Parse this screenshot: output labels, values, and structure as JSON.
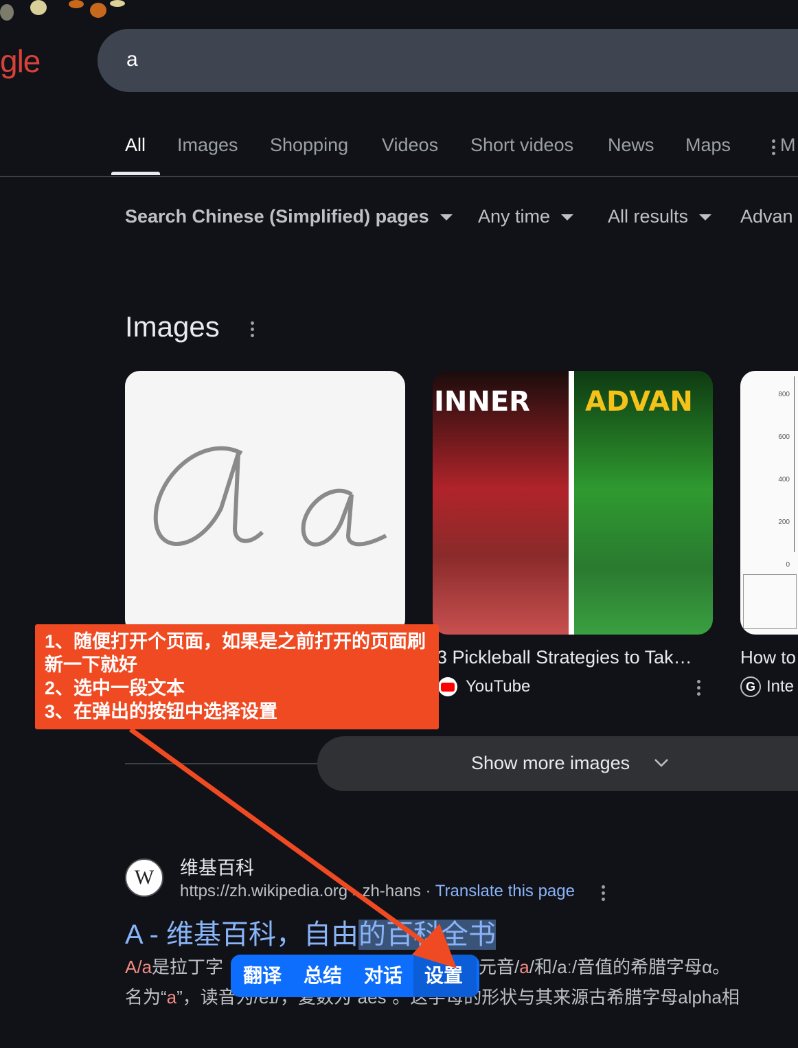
{
  "header": {
    "logo": "gle",
    "search_value": "a"
  },
  "tabs": [
    {
      "label": "All",
      "active": true
    },
    {
      "label": "Images"
    },
    {
      "label": "Shopping"
    },
    {
      "label": "Videos"
    },
    {
      "label": "Short videos"
    },
    {
      "label": "News"
    },
    {
      "label": "Maps"
    },
    {
      "label": "M"
    }
  ],
  "filters": [
    "Search Chinese (Simplified) pages",
    "Any time",
    "All results",
    "Advan"
  ],
  "images_section": {
    "heading": "Images",
    "cards": [
      {
        "caption": "",
        "source": ""
      },
      {
        "caption": "3 Pickleball Strategies to Tak…",
        "source": "YouTube",
        "overlay_text_left": "INNER",
        "overlay_text_right": "ADVAN"
      },
      {
        "caption": "How to",
        "source": "Inte",
        "chart_ticks": [
          "800",
          "600",
          "400",
          "200",
          "0"
        ]
      }
    ],
    "show_more": "Show more images"
  },
  "callout": {
    "lines": [
      "1、随便打开个页面，如果是之前打开的页面刷新一下就好",
      "2、选中一段文本",
      "3、在弹出的按钮中选择设置"
    ],
    "color": "#f04a23"
  },
  "result": {
    "site_name": "维基百科",
    "url": "https://zh.wikipedia.org › zh-hans",
    "translate": "Translate this page",
    "title_plain": "A - 维基百科，自由",
    "title_selected": "的百科全书",
    "snippet_line1_a": "A/a",
    "snippet_line1_b": "是拉丁字",
    "snippet_line1_c": "有低元音/",
    "snippet_line1_d": "a",
    "snippet_line1_e": "/和/aː/音值的希腊字母α。 ",
    "snippet_line2_a": "名为“",
    "snippet_line2_b": "a",
    "snippet_line2_c": "”，读音为/eɪ/，复数为“aes”。这",
    "snippet_line2_d": "字母的形状与其来源古希腊字母alpha相"
  },
  "popup": {
    "buttons": [
      "翻译",
      "总结",
      "对话",
      "设置"
    ],
    "color": "#0d6efd"
  }
}
